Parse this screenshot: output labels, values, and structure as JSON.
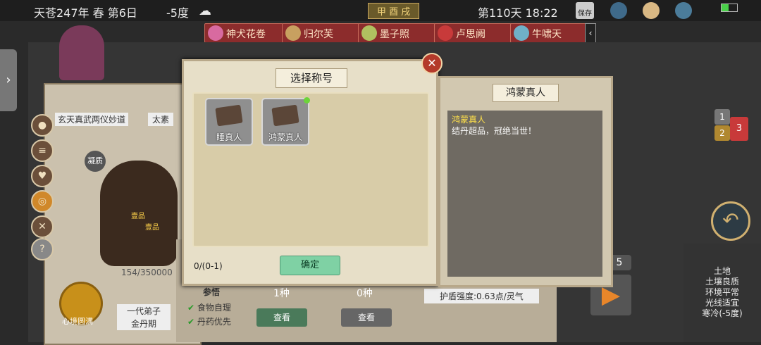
{
  "status": {
    "date": "天苍247年 春 第6日",
    "temperature": "-5度",
    "cycle": "甲 酉 戌",
    "day_time": "第110天 18:22",
    "save": "保存"
  },
  "disciples": [
    {
      "name": "神犬花卷"
    },
    {
      "name": "归尔芙"
    },
    {
      "name": "墨子照"
    },
    {
      "name": "卢思阙"
    },
    {
      "name": "牛啸天"
    }
  ],
  "character": {
    "cultivation_method": "玄天真武两仪妙道",
    "element": "太素",
    "exp": "154/350000",
    "realm_bottom": "心境圆满",
    "rank": "一代弟子",
    "stage": "金丹期",
    "section_title": "参悟",
    "checks": [
      "食物自理",
      "丹药优先"
    ],
    "body_quality": "凝质",
    "marks": [
      "壹品",
      "壹品"
    ]
  },
  "dialog": {
    "title": "选择称号",
    "titles": [
      {
        "name": "睡真人"
      },
      {
        "name": "鸿蒙真人"
      }
    ],
    "count": "0/(0-1)",
    "confirm": "确定"
  },
  "detail": {
    "title": "鸿蒙真人",
    "name": "鸿蒙真人",
    "description": "结丹超品，冠绝当世！"
  },
  "bottom": {
    "kind_count_1": "1种",
    "kind_count_2": "0种",
    "view_1": "查看",
    "view_2": "查看",
    "shield": "护盾强度:0.63点/灵气",
    "badge": "5"
  },
  "side_badges": [
    "1",
    "2",
    "3"
  ],
  "environment": [
    "土地",
    "土壤良质",
    "环境平常",
    "光线适宜",
    "寒冷(-5度)"
  ],
  "colors": {
    "accent_red": "#8c2c2c",
    "confirm_green": "#7fd1a4",
    "highlight_yellow": "#ffe04a"
  }
}
